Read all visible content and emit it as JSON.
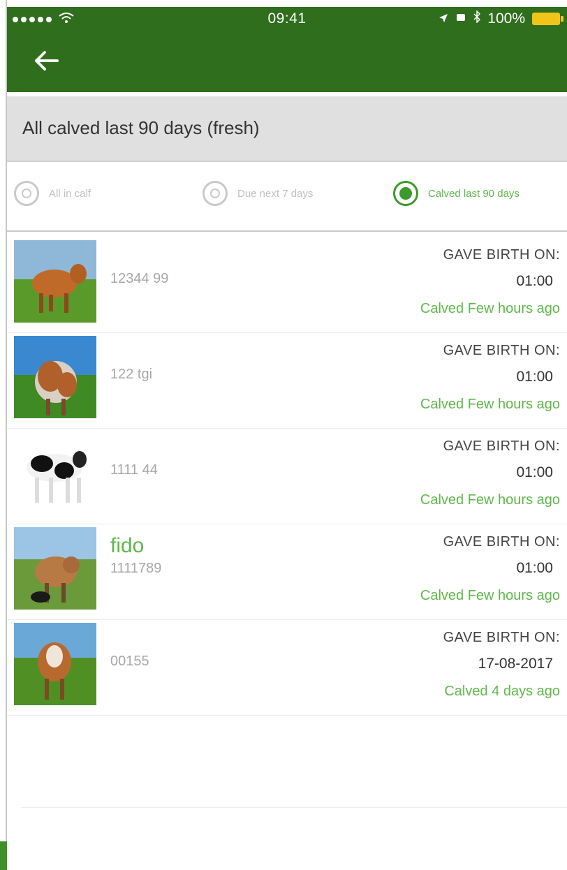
{
  "status_bar": {
    "time": "09:41",
    "battery": "100%"
  },
  "filter": {
    "title": "All calved last 90 days (fresh)"
  },
  "tabs": [
    {
      "label": "All in calf",
      "selected": false
    },
    {
      "label": "Due next 7 days",
      "selected": false
    },
    {
      "label": "Calved last 90 days",
      "selected": true
    }
  ],
  "cows": [
    {
      "name": "",
      "id": "12344 99",
      "gave_birth_label": "GAVE BIRTH ON:",
      "time": "01:00",
      "status": "Calved Few hours ago"
    },
    {
      "name": "",
      "id": "122 tgi",
      "gave_birth_label": "GAVE BIRTH ON:",
      "time": "01:00",
      "status": "Calved Few hours ago"
    },
    {
      "name": "",
      "id": "1111 44",
      "gave_birth_label": "GAVE BIRTH ON:",
      "time": "01:00",
      "status": "Calved Few hours ago"
    },
    {
      "name": "fido",
      "id": "1111789",
      "gave_birth_label": "GAVE BIRTH ON:",
      "time": "01:00",
      "status": "Calved Few hours ago"
    },
    {
      "name": "",
      "id": "00155",
      "gave_birth_label": "GAVE BIRTH ON:",
      "time": "17-08-2017",
      "status": "Calved 4 days ago"
    }
  ],
  "colors": {
    "header": "#2f6e1c",
    "accent": "#5fb84a",
    "radio_active": "#3c9a2a",
    "filter_bar": "#e0e0e0"
  },
  "icons": {
    "back": "back-arrow-icon",
    "signal": "signal-dots-icon",
    "wifi": "wifi-icon",
    "location": "location-arrow-icon",
    "bluetooth": "bluetooth-icon",
    "battery": "battery-icon"
  }
}
